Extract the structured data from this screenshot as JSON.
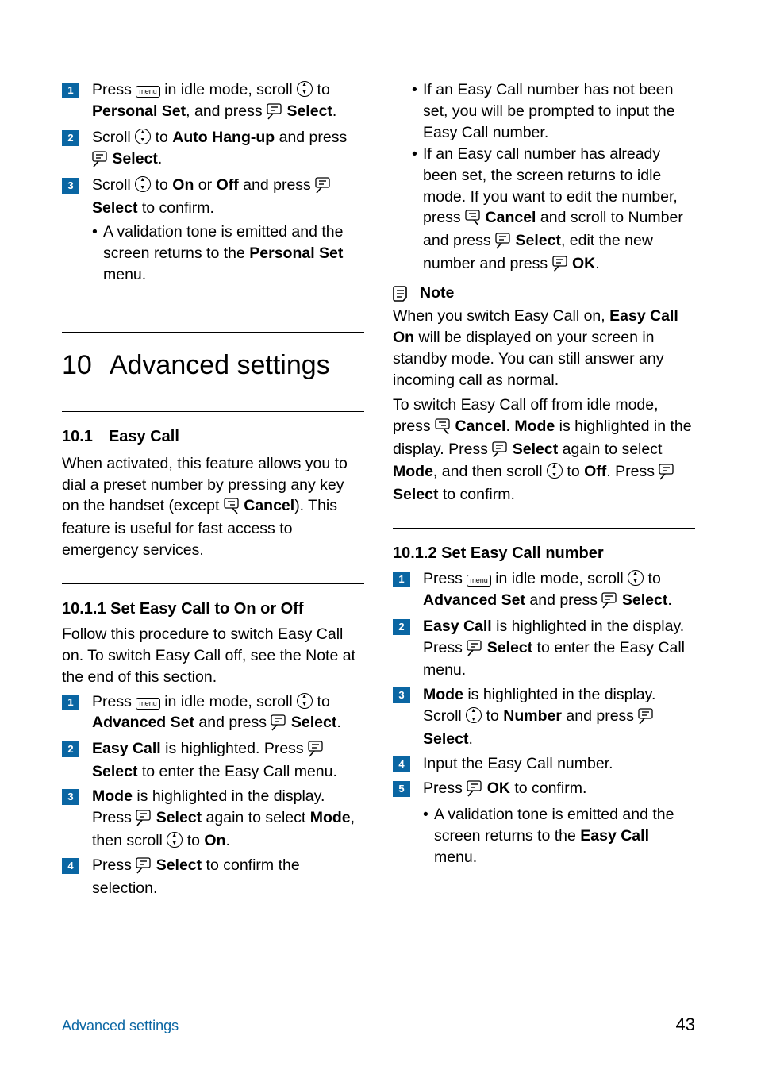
{
  "colors": {
    "accent": "#0a66a3"
  },
  "icons": {
    "menu": "menu",
    "nav": "nav-wheel",
    "soft_left": "soft-key-left",
    "soft_right": "soft-key-right",
    "note": "note-icon"
  },
  "top_steps": {
    "s1": {
      "num": "1",
      "a": "Press ",
      "b": " in idle mode, scroll ",
      "c": " to ",
      "bold1": "Personal Set",
      "d": ", and press ",
      "bold2": "Select",
      "e": "."
    },
    "s2": {
      "num": "2",
      "a": "Scroll ",
      "b": " to ",
      "bold1": "Auto Hang-up",
      "c": " and press ",
      "bold2": "Select",
      "d": "."
    },
    "s3": {
      "num": "3",
      "a": "Scroll ",
      "b": " to ",
      "bold1": "On",
      "c": " or ",
      "bold2": "Off",
      "d": " and press ",
      "bold3": "Select",
      "e": " to confirm."
    },
    "s3_bullet": {
      "a": "A validation tone is emitted and the screen returns to the ",
      "bold1": "Personal Set",
      "b": " menu."
    }
  },
  "chapter": {
    "num": "10",
    "title": "Advanced settings"
  },
  "sec101": {
    "num": "10.1",
    "title": "Easy Call",
    "p1a": "When activated, this feature allows you to dial a preset number by pressing any key on the handset (except ",
    "p1b_bold": "Cancel",
    "p1c": "). This feature is useful for fast access to emergency services."
  },
  "sec1011": {
    "title": "10.1.1 Set Easy Call to On or Off",
    "p": "Follow this procedure to switch Easy Call on. To switch Easy Call off, see the Note at the end of this section.",
    "s1": {
      "num": "1",
      "a": "Press ",
      "b": " in idle mode, scroll ",
      "c": " to ",
      "bold1": "Advanced Set",
      "d": " and press ",
      "bold2": "Select",
      "e": "."
    },
    "s2": {
      "num": "2",
      "bold1": "Easy Call",
      "a": " is highlighted. Press ",
      "bold2": "Select",
      "b": " to enter the Easy Call menu."
    },
    "s3": {
      "num": "3",
      "bold1": "Mode",
      "a": " is highlighted in the display. Press ",
      "bold2": "Select",
      "b": " again to select ",
      "bold3": "Mode",
      "c": ", then scroll ",
      "d": " to ",
      "bold4": "On",
      "e": "."
    },
    "s4": {
      "num": "4",
      "a": "Press ",
      "bold1": "Select",
      "b": " to confirm the selection."
    }
  },
  "col2_bullets": {
    "b1": "If an Easy Call number has not been set, you will be prompted to input the Easy Call number.",
    "b2": {
      "a": "If an Easy call number has already been set, the screen returns to idle mode. If you want to edit the number, press ",
      "bold1": "Cancel",
      "b": " and scroll to Number and press ",
      "bold2": "Select",
      "c": ", edit the new number and press ",
      "bold3": "OK",
      "d": "."
    }
  },
  "note": {
    "label": "Note",
    "p1a": "When you switch Easy Call on, ",
    "p1bold1": "Easy Call On",
    "p1b": " will be displayed on your screen in standby mode. You can still answer any incoming call as normal.",
    "p2a": "To switch Easy Call off from idle mode, press ",
    "p2bold1": "Cancel",
    "p2b": ". ",
    "p2bold2": "Mode",
    "p2c": " is highlighted in the display. Press ",
    "p2bold3": "Select",
    "p2d": " again to select ",
    "p2bold4": "Mode",
    "p2e": ", and then scroll ",
    "p2f": " to ",
    "p2bold5": "Off",
    "p2g": ". Press ",
    "p2bold6": "Select",
    "p2h": " to confirm."
  },
  "sec1012": {
    "title": "10.1.2 Set Easy Call number",
    "s1": {
      "num": "1",
      "a": "Press ",
      "b": " in idle mode, scroll ",
      "c": " to ",
      "bold1": "Advanced Set",
      "d": " and press ",
      "bold2": "Select",
      "e": "."
    },
    "s2": {
      "num": "2",
      "bold1": "Easy Call",
      "a": " is highlighted in the display. Press ",
      "bold2": "Select",
      "b": " to enter the Easy Call menu."
    },
    "s3": {
      "num": "3",
      "bold1": "Mode",
      "a": " is highlighted in the display. Scroll ",
      "b": " to ",
      "bold2": "Number",
      "c": " and press ",
      "bold3": "Select",
      "d": "."
    },
    "s4": {
      "num": "4",
      "a": "Input the Easy Call number."
    },
    "s5": {
      "num": "5",
      "a": "Press ",
      "bold1": "OK",
      "b": " to confirm."
    },
    "s5_bullet": {
      "a": "A validation tone is emitted and the screen returns to the ",
      "bold1": "Easy Call",
      "b": " menu."
    }
  },
  "footer": {
    "left": "Advanced settings",
    "right": "43"
  }
}
